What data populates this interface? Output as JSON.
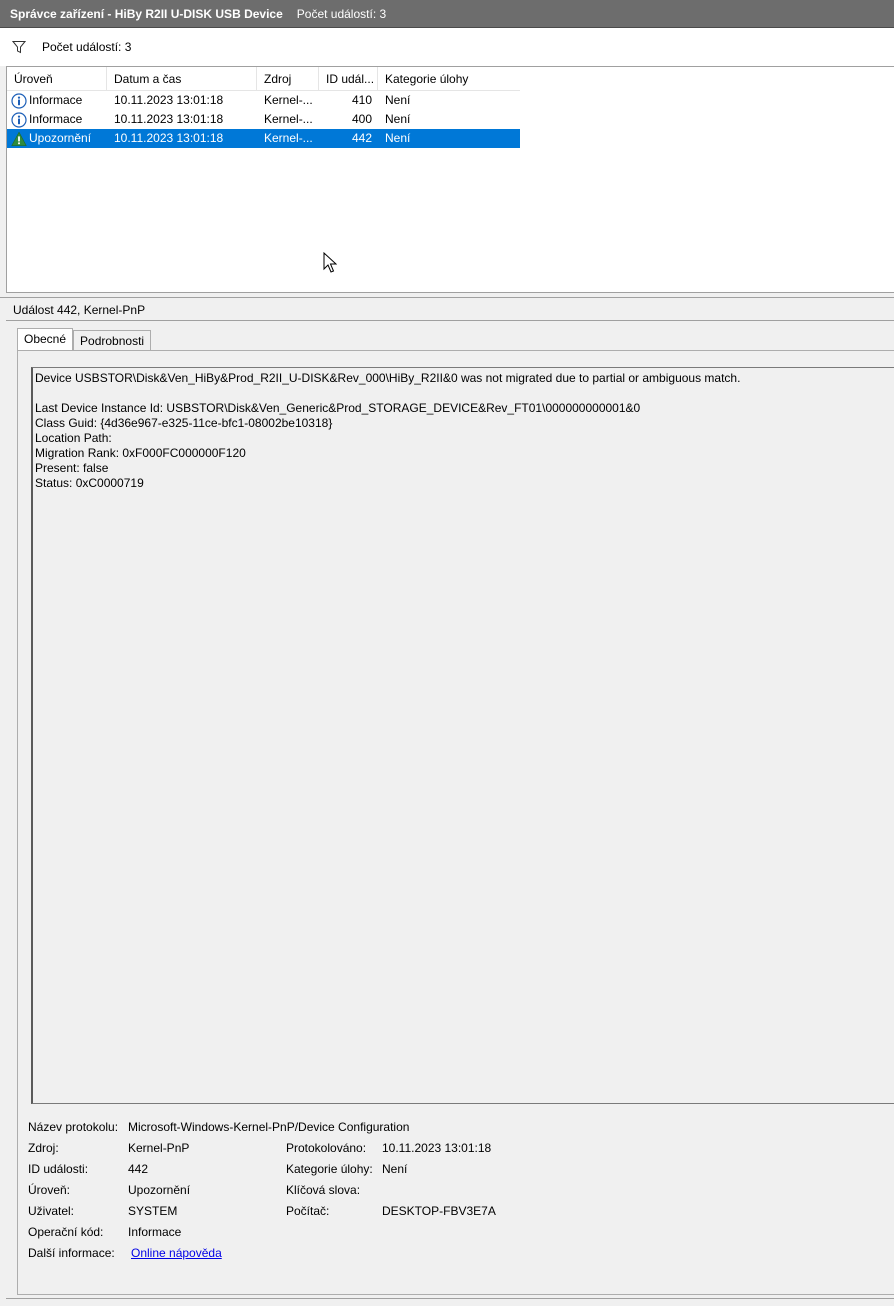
{
  "window": {
    "title": "Správce zařízení - HiBy R2II U-DISK USB Device",
    "event_count_title": "Počet událostí: 3"
  },
  "filter": {
    "icon": "filter-icon",
    "label": "Počet událostí: 3"
  },
  "events_table": {
    "columns": [
      "Úroveň",
      "Datum a čas",
      "Zdroj",
      "ID udál...",
      "Kategorie úlohy"
    ],
    "rows": [
      {
        "level": "Informace",
        "level_icon": "info-icon",
        "datetime": "10.11.2023 13:01:18",
        "source": "Kernel-...",
        "id": "410",
        "category": "Není",
        "selected": false
      },
      {
        "level": "Informace",
        "level_icon": "info-icon",
        "datetime": "10.11.2023 13:01:18",
        "source": "Kernel-...",
        "id": "400",
        "category": "Není",
        "selected": false
      },
      {
        "level": "Upozornění",
        "level_icon": "warning-icon",
        "datetime": "10.11.2023 13:01:18",
        "source": "Kernel-...",
        "id": "442",
        "category": "Není",
        "selected": true
      }
    ]
  },
  "detail": {
    "header": "Událost 442, Kernel-PnP",
    "tabs": [
      {
        "label": "Obecné",
        "active": true
      },
      {
        "label": "Podrobnosti",
        "active": false
      }
    ],
    "message": "Device USBSTOR\\Disk&Ven_HiBy&Prod_R2II_U-DISK&Rev_000\\HiBy_R2II&0 was not migrated due to partial or ambiguous match.\n\nLast Device Instance Id: USBSTOR\\Disk&Ven_Generic&Prod_STORAGE_DEVICE&Rev_FT01\\000000000001&0\nClass Guid: {4d36e967-e325-11ce-bfc1-08002be10318}\nLocation Path:\nMigration Rank: 0xF000FC000000F120\nPresent: false\nStatus: 0xC0000719",
    "properties": {
      "log_name_label": "Název protokolu:",
      "log_name_value": "Microsoft-Windows-Kernel-PnP/Device Configuration",
      "source_label": "Zdroj:",
      "source_value": "Kernel-PnP",
      "logged_label": "Protokolováno:",
      "logged_value": "10.11.2023 13:01:18",
      "event_id_label": "ID události:",
      "event_id_value": "442",
      "task_category_label": "Kategorie úlohy:",
      "task_category_value": "Není",
      "level_label": "Úroveň:",
      "level_value": "Upozornění",
      "keywords_label": "Klíčová slova:",
      "keywords_value": "",
      "user_label": "Uživatel:",
      "user_value": "SYSTEM",
      "computer_label": "Počítač:",
      "computer_value": "DESKTOP-FBV3E7A",
      "opcode_label": "Operační kód:",
      "opcode_value": "Informace",
      "more_info_label": "Další informace:",
      "more_info_link": "Online nápověda"
    }
  },
  "colors": {
    "titlebar": "#6d6d6d",
    "selection": "#0078d7",
    "link": "#0000e6",
    "info_icon": "#1c5fb8",
    "warning_icon": "#2e8b3e"
  }
}
